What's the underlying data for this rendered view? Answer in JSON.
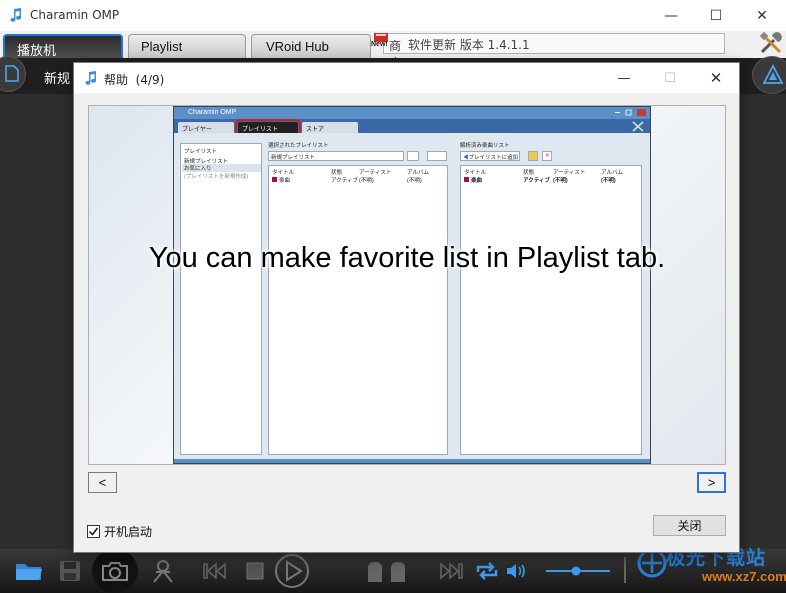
{
  "main_window": {
    "title": "Charamin OMP",
    "controls": {
      "minimize": "—",
      "maximize": "☐",
      "close": "✕"
    }
  },
  "main_tabs": [
    {
      "label": "播放机",
      "active": true
    },
    {
      "label": "Playlist",
      "active": false
    },
    {
      "label": "VRoid Hub",
      "active": false
    }
  ],
  "update_notice": {
    "badge": "New!",
    "overlay_text": "商店",
    "text": "软件更新 版本 1.4.1.1"
  },
  "toolbar": {
    "new_label": "新规"
  },
  "help_dialog": {
    "title": "帮助",
    "page": "(4/9)",
    "caption": "You can make favorite list in Playlist tab.",
    "nav_prev": "<",
    "nav_next": ">",
    "autostart_label": "开机启动",
    "autostart_checked": true,
    "close_label": "关闭"
  },
  "screenshot_inner": {
    "window_title": "Charamin OMP",
    "tabs": [
      {
        "label": "プレイヤー",
        "active": false
      },
      {
        "label": "プレイリスト",
        "active": true
      },
      {
        "label": "ストア",
        "active": false
      }
    ],
    "left_panel": {
      "header": "プレイリスト",
      "items": [
        "新規プレイリスト",
        "お気に入り",
        "(プレイリストを新規作成)"
      ]
    },
    "middle_panel": {
      "header": "選択されたプレイリスト",
      "name_value": "新規プレイリスト",
      "columns": [
        "タイトル",
        "状態",
        "アーティスト",
        "アルバム"
      ],
      "row": [
        "楽曲",
        "アクティブ",
        "(不明)",
        "(不明)"
      ]
    },
    "right_panel": {
      "header": "解析済み楽曲リスト",
      "add_button": "プレイリストに追加",
      "columns": [
        "タイトル",
        "状態",
        "アーティスト",
        "アルバム"
      ],
      "row": [
        "楽曲",
        "アクティブ",
        "(不明)",
        "(不明)"
      ]
    }
  },
  "watermark": {
    "text": "极光下载站",
    "url": "www.xz7.com"
  },
  "colors": {
    "accent_blue": "#2d74d6",
    "player_dark": "#2e2e2e",
    "highlight_red": "#d0201e",
    "watermark_blue": "#2a7fd6",
    "watermark_orange": "#e07a19"
  }
}
